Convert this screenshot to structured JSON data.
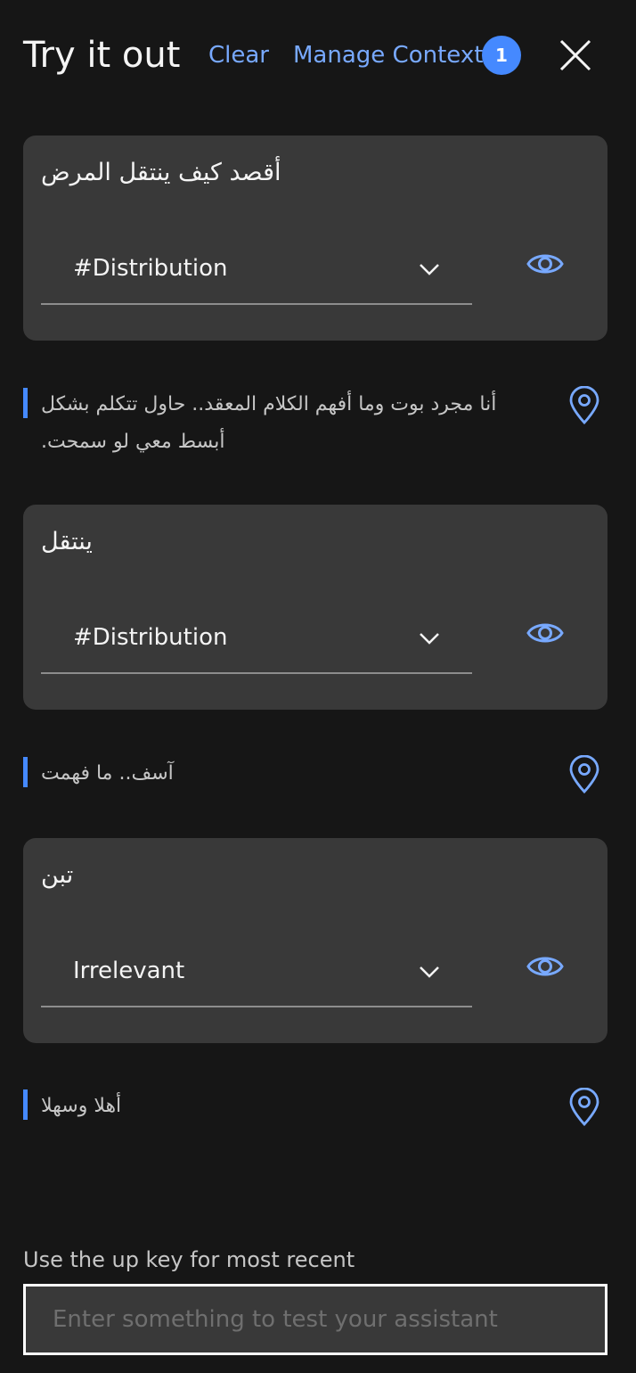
{
  "header": {
    "title": "Try it out",
    "clear_label": "Clear",
    "manage_context_label": "Manage Context",
    "context_count": "1",
    "close_icon": "close-icon"
  },
  "conversation": [
    {
      "user_message": "أقصد كيف ينتقل المرض",
      "intent": "#Distribution",
      "bot_response": "أنا مجرد بوت وما أفهم الكلام المعقد.. حاول تتكلم بشكل أبسط معي لو سمحت."
    },
    {
      "user_message": "ينتقل",
      "intent": "#Distribution",
      "bot_response": "آسف.. ما فهمت"
    },
    {
      "user_message": "تبن",
      "intent": "Irrelevant",
      "bot_response": "أهلا وسهلا"
    }
  ],
  "input": {
    "hint": "Use the up key for most recent",
    "placeholder": "Enter something to test your assistant",
    "value": ""
  },
  "colors": {
    "background": "#161616",
    "card": "#393939",
    "accent": "#78a9ff",
    "badge": "#4589ff",
    "response_bar": "#4589ff"
  }
}
